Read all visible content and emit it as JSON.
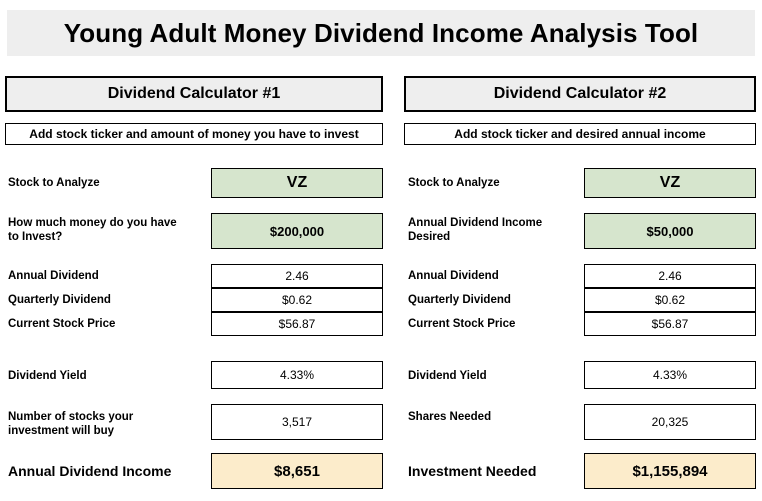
{
  "app": {
    "title": "Young Adult Money Dividend Income Analysis Tool"
  },
  "calculators": [
    {
      "header": "Dividend Calculator #1",
      "instruction": "Add stock ticker and amount of money you have to invest",
      "fields": {
        "ticker_label": "Stock to Analyze",
        "ticker_value": "VZ",
        "amount_label": "How much money do you have\nto Invest?",
        "amount_value": "$200,000",
        "annual_dividend_label": "Annual Dividend",
        "annual_dividend_value": "2.46",
        "quarterly_dividend_label": "Quarterly Dividend",
        "quarterly_dividend_value": "$0.62",
        "stock_price_label": "Current Stock Price",
        "stock_price_value": "$56.87",
        "yield_label": "Dividend Yield",
        "yield_value": "4.33%",
        "shares_label": "Number of stocks your\ninvestment will buy",
        "shares_value": "3,517",
        "result_label": "Annual Dividend Income",
        "result_value": "$8,651"
      }
    },
    {
      "header": "Dividend Calculator #2",
      "instruction": "Add stock ticker and desired annual income",
      "fields": {
        "ticker_label": "Stock to Analyze",
        "ticker_value": "VZ",
        "amount_label": "Annual Dividend Income\nDesired",
        "amount_value": "$50,000",
        "annual_dividend_label": "Annual Dividend",
        "annual_dividend_value": "2.46",
        "quarterly_dividend_label": "Quarterly Dividend",
        "quarterly_dividend_value": "$0.62",
        "stock_price_label": "Current Stock Price",
        "stock_price_value": "$56.87",
        "yield_label": "Dividend Yield",
        "yield_value": "4.33%",
        "shares_label": "Shares Needed",
        "shares_value": "20,325",
        "result_label": "Investment Needed",
        "result_value": "$1,155,894"
      }
    }
  ],
  "colors": {
    "title_background": "#eeeeee",
    "header_background": "#eeeeee",
    "input_background": "#d6e5cd",
    "result_background": "#fceccb",
    "border": "#000000",
    "page_background": "#ffffff"
  }
}
